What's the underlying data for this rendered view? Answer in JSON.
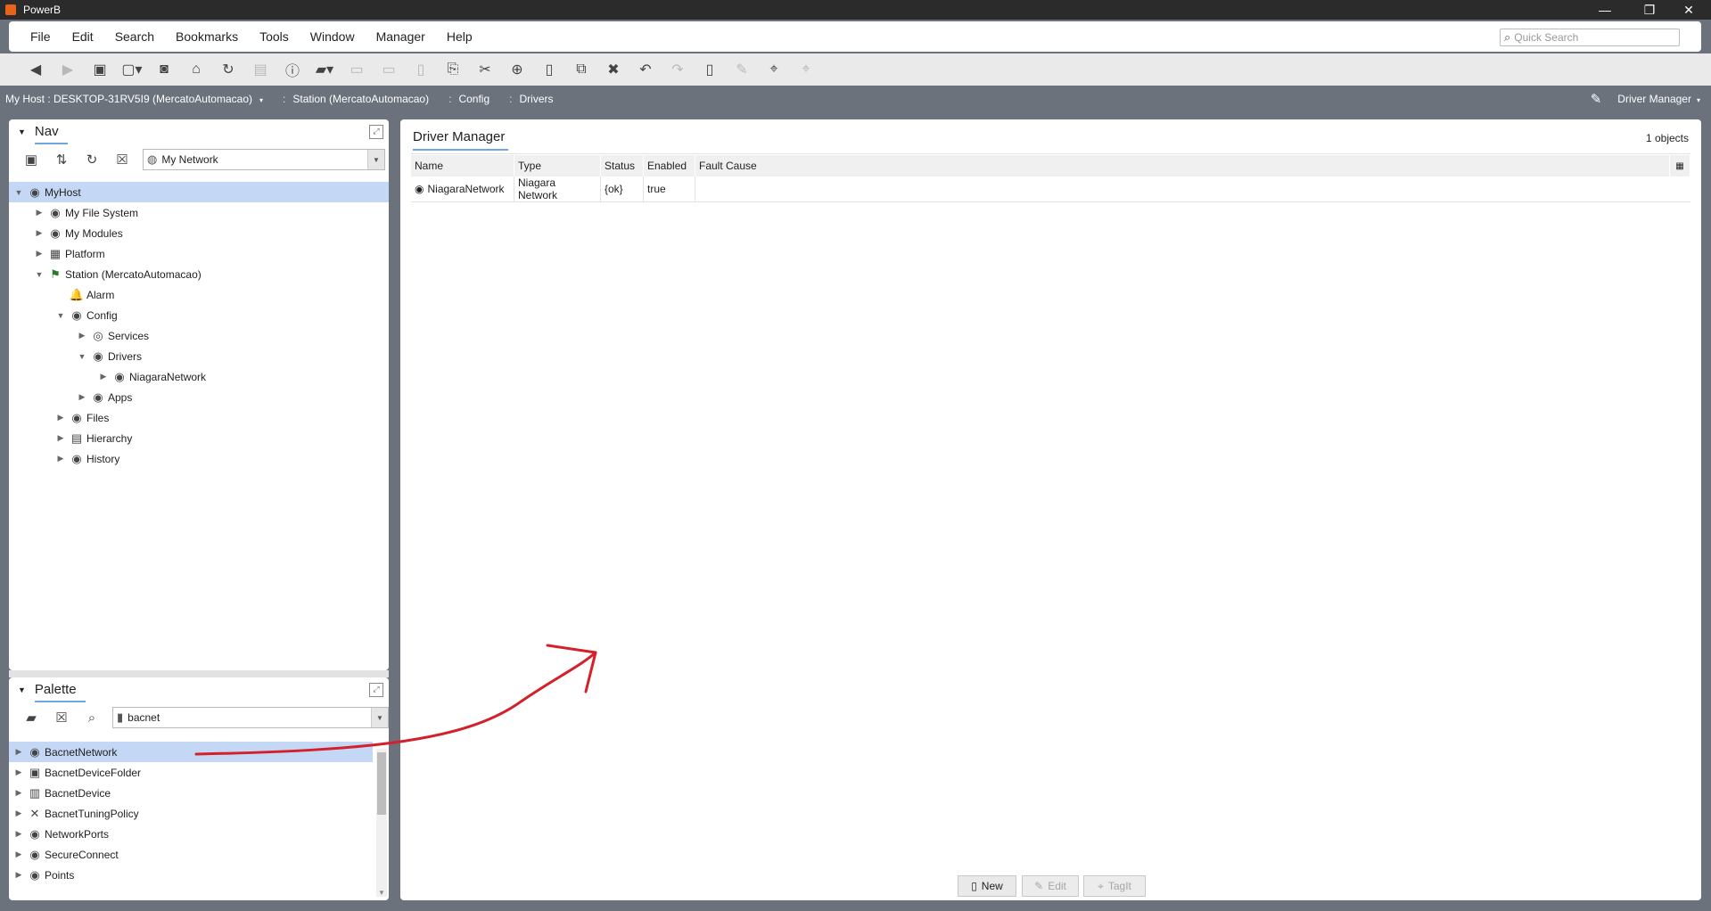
{
  "window": {
    "title": "PowerB",
    "controls": {
      "minimize": "—",
      "restore": "❐",
      "close": "✕"
    }
  },
  "menubar": {
    "items": [
      "File",
      "Edit",
      "Search",
      "Bookmarks",
      "Tools",
      "Window",
      "Manager",
      "Help"
    ],
    "quick_search_placeholder": "Quick Search"
  },
  "toolbar": {
    "icons": [
      "back-icon",
      "forward-icon",
      "up-level-icon",
      "view-menu-icon",
      "screenshot-icon",
      "home-icon",
      "refresh-icon",
      "disabled-doc-icon",
      "info-icon",
      "open-folder-icon",
      "save-icon",
      "save-all-icon",
      "export-icon",
      "spy-icon",
      "cut-icon",
      "copy-icon",
      "paste-icon",
      "duplicate-icon",
      "delete-icon",
      "undo-icon",
      "redo-icon",
      "new-doc-icon",
      "rename-icon",
      "tag-icon",
      "batch-tag-icon"
    ]
  },
  "pathbar": {
    "crumbs": [
      "My Host : DESKTOP-31RV5I9 (MercatoAutomacao)",
      "Station (MercatoAutomacao)",
      "Config",
      "Drivers"
    ],
    "view_selector": "Driver Manager"
  },
  "nav": {
    "title": "Nav",
    "network_select": "My Network",
    "tree": [
      {
        "label": "MyHost",
        "exp": "▼",
        "icon": "◉",
        "selected": true
      },
      {
        "label": "My File System",
        "exp": "▶",
        "icon": "◉"
      },
      {
        "label": "My Modules",
        "exp": "▶",
        "icon": "◉"
      },
      {
        "label": "Platform",
        "exp": "▶",
        "icon": "▦"
      },
      {
        "label": "Station (MercatoAutomacao)",
        "exp": "▼",
        "icon": "⚑"
      },
      {
        "label": "Alarm",
        "exp": "",
        "icon": "🔔"
      },
      {
        "label": "Config",
        "exp": "▼",
        "icon": "◉"
      },
      {
        "label": "Services",
        "exp": "▶",
        "icon": "◎"
      },
      {
        "label": "Drivers",
        "exp": "▼",
        "icon": "◉"
      },
      {
        "label": "NiagaraNetwork",
        "exp": "▶",
        "icon": "◉"
      },
      {
        "label": "Apps",
        "exp": "▶",
        "icon": "◉"
      },
      {
        "label": "Files",
        "exp": "▶",
        "icon": "◉"
      },
      {
        "label": "Hierarchy",
        "exp": "▶",
        "icon": "▤"
      },
      {
        "label": "History",
        "exp": "▶",
        "icon": "◉"
      }
    ]
  },
  "palette": {
    "title": "Palette",
    "module_select": "bacnet",
    "items": [
      {
        "label": "BacnetNetwork",
        "icon": "◉",
        "selected": true
      },
      {
        "label": "BacnetDeviceFolder",
        "icon": "▣"
      },
      {
        "label": "BacnetDevice",
        "icon": "▥"
      },
      {
        "label": "BacnetTuningPolicy",
        "icon": "✕"
      },
      {
        "label": "NetworkPorts",
        "icon": "◉"
      },
      {
        "label": "SecureConnect",
        "icon": "◉"
      },
      {
        "label": "Points",
        "icon": "◉"
      }
    ]
  },
  "driver_manager": {
    "title": "Driver Manager",
    "object_count": "1 objects",
    "columns": [
      "Name",
      "Type",
      "Status",
      "Enabled",
      "Fault Cause"
    ],
    "rows": [
      {
        "name": "NiagaraNetwork",
        "type": "Niagara Network",
        "status": "{ok}",
        "enabled": "true",
        "fault_cause": ""
      }
    ],
    "buttons": {
      "new": "New",
      "edit": "Edit",
      "tagit": "TagIt"
    }
  },
  "colors": {
    "chrome": "#6b727c",
    "titlebar": "#2b2b2b",
    "selection": "#c4d8f5",
    "annotation_arrow": "#d4202a"
  }
}
